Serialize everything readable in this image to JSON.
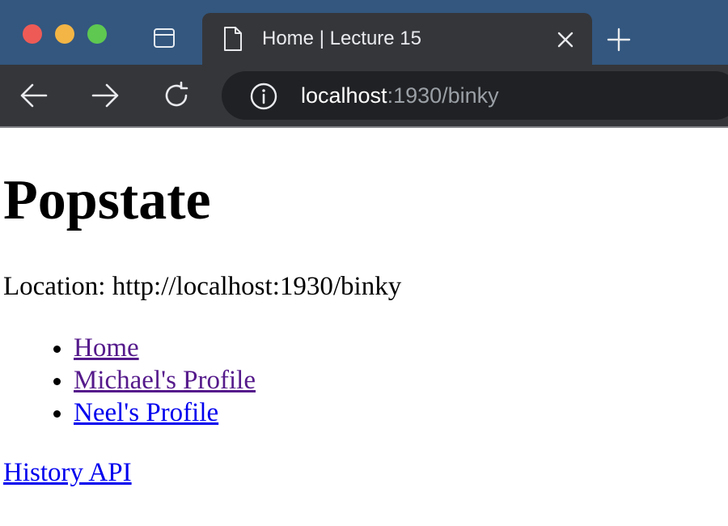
{
  "browser": {
    "tab_title": "Home | Lecture 15",
    "url_host": "localhost",
    "url_rest": ":1930/binky"
  },
  "page": {
    "title": "Popstate",
    "location": "Location: http://localhost:1930/binky",
    "nav_links": [
      {
        "label": "Home",
        "state": "visited"
      },
      {
        "label": "Michael's Profile",
        "state": "visited"
      },
      {
        "label": "Neel's Profile",
        "state": "unvisited"
      }
    ],
    "history_link": "History API"
  },
  "colors": {
    "tabbar": "#33577f",
    "chrome": "#35363a",
    "omnibox": "#202124",
    "link_visited": "#551a8b",
    "link_unvisited": "#0000ee"
  },
  "icons": {
    "window_controls": [
      "close-window-icon",
      "minimize-window-icon",
      "zoom-window-icon"
    ],
    "tab": [
      "sidebar-toggle-icon",
      "page-icon",
      "close-icon",
      "plus-icon"
    ],
    "toolbar": [
      "back-arrow-icon",
      "forward-arrow-icon",
      "reload-icon",
      "info-icon"
    ]
  }
}
